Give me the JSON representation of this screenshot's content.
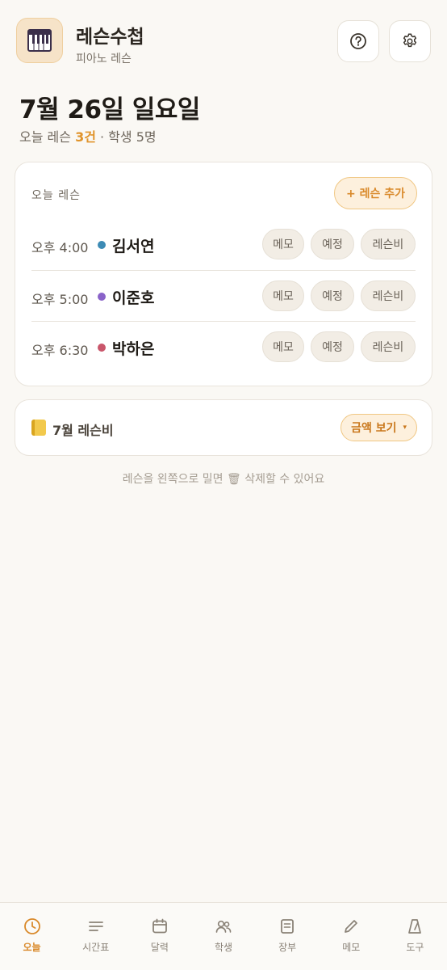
{
  "header": {
    "app_title": "레슨수첩",
    "app_subtitle": "피아노 레슨",
    "app_icon": "piano-icon",
    "help_icon": "help-circle-icon",
    "settings_icon": "gear-icon"
  },
  "date": {
    "title": "7월 26일 일요일",
    "summary_prefix": "오늘 레슨 ",
    "summary_count": "3건",
    "summary_suffix": " · 학생 5명"
  },
  "today_card": {
    "label": "오늘 레슨",
    "add_button": "+ 레슨 추가",
    "lessons": [
      {
        "time": "오후 4:00",
        "name": "김서연",
        "color": "#3d8bb5",
        "memo": "메모",
        "plan": "예정",
        "fee": "레슨비"
      },
      {
        "time": "오후 5:00",
        "name": "이준호",
        "color": "#8a63c9",
        "memo": "메모",
        "plan": "예정",
        "fee": "레슨비"
      },
      {
        "time": "오후 6:30",
        "name": "박하은",
        "color": "#c9566b",
        "memo": "메모",
        "plan": "예정",
        "fee": "레슨비"
      }
    ]
  },
  "fee_card": {
    "icon": "notebook-icon",
    "label": "7월 레슨비",
    "button": "금액 보기",
    "caret": "▾"
  },
  "hint": "레슨을 왼쪽으로 밀면 🗑 삭제할 수 있어요",
  "tabs": [
    {
      "label": "오늘",
      "icon": "clock-icon",
      "active": true
    },
    {
      "label": "시간표",
      "icon": "list-icon",
      "active": false
    },
    {
      "label": "달력",
      "icon": "calendar-icon",
      "active": false
    },
    {
      "label": "학생",
      "icon": "users-icon",
      "active": false
    },
    {
      "label": "장부",
      "icon": "ledger-icon",
      "active": false
    },
    {
      "label": "메모",
      "icon": "pencil-icon",
      "active": false
    },
    {
      "label": "도구",
      "icon": "metronome-icon",
      "active": false
    }
  ],
  "colors": {
    "accent": "#e0932a",
    "background": "#faf8f4"
  }
}
